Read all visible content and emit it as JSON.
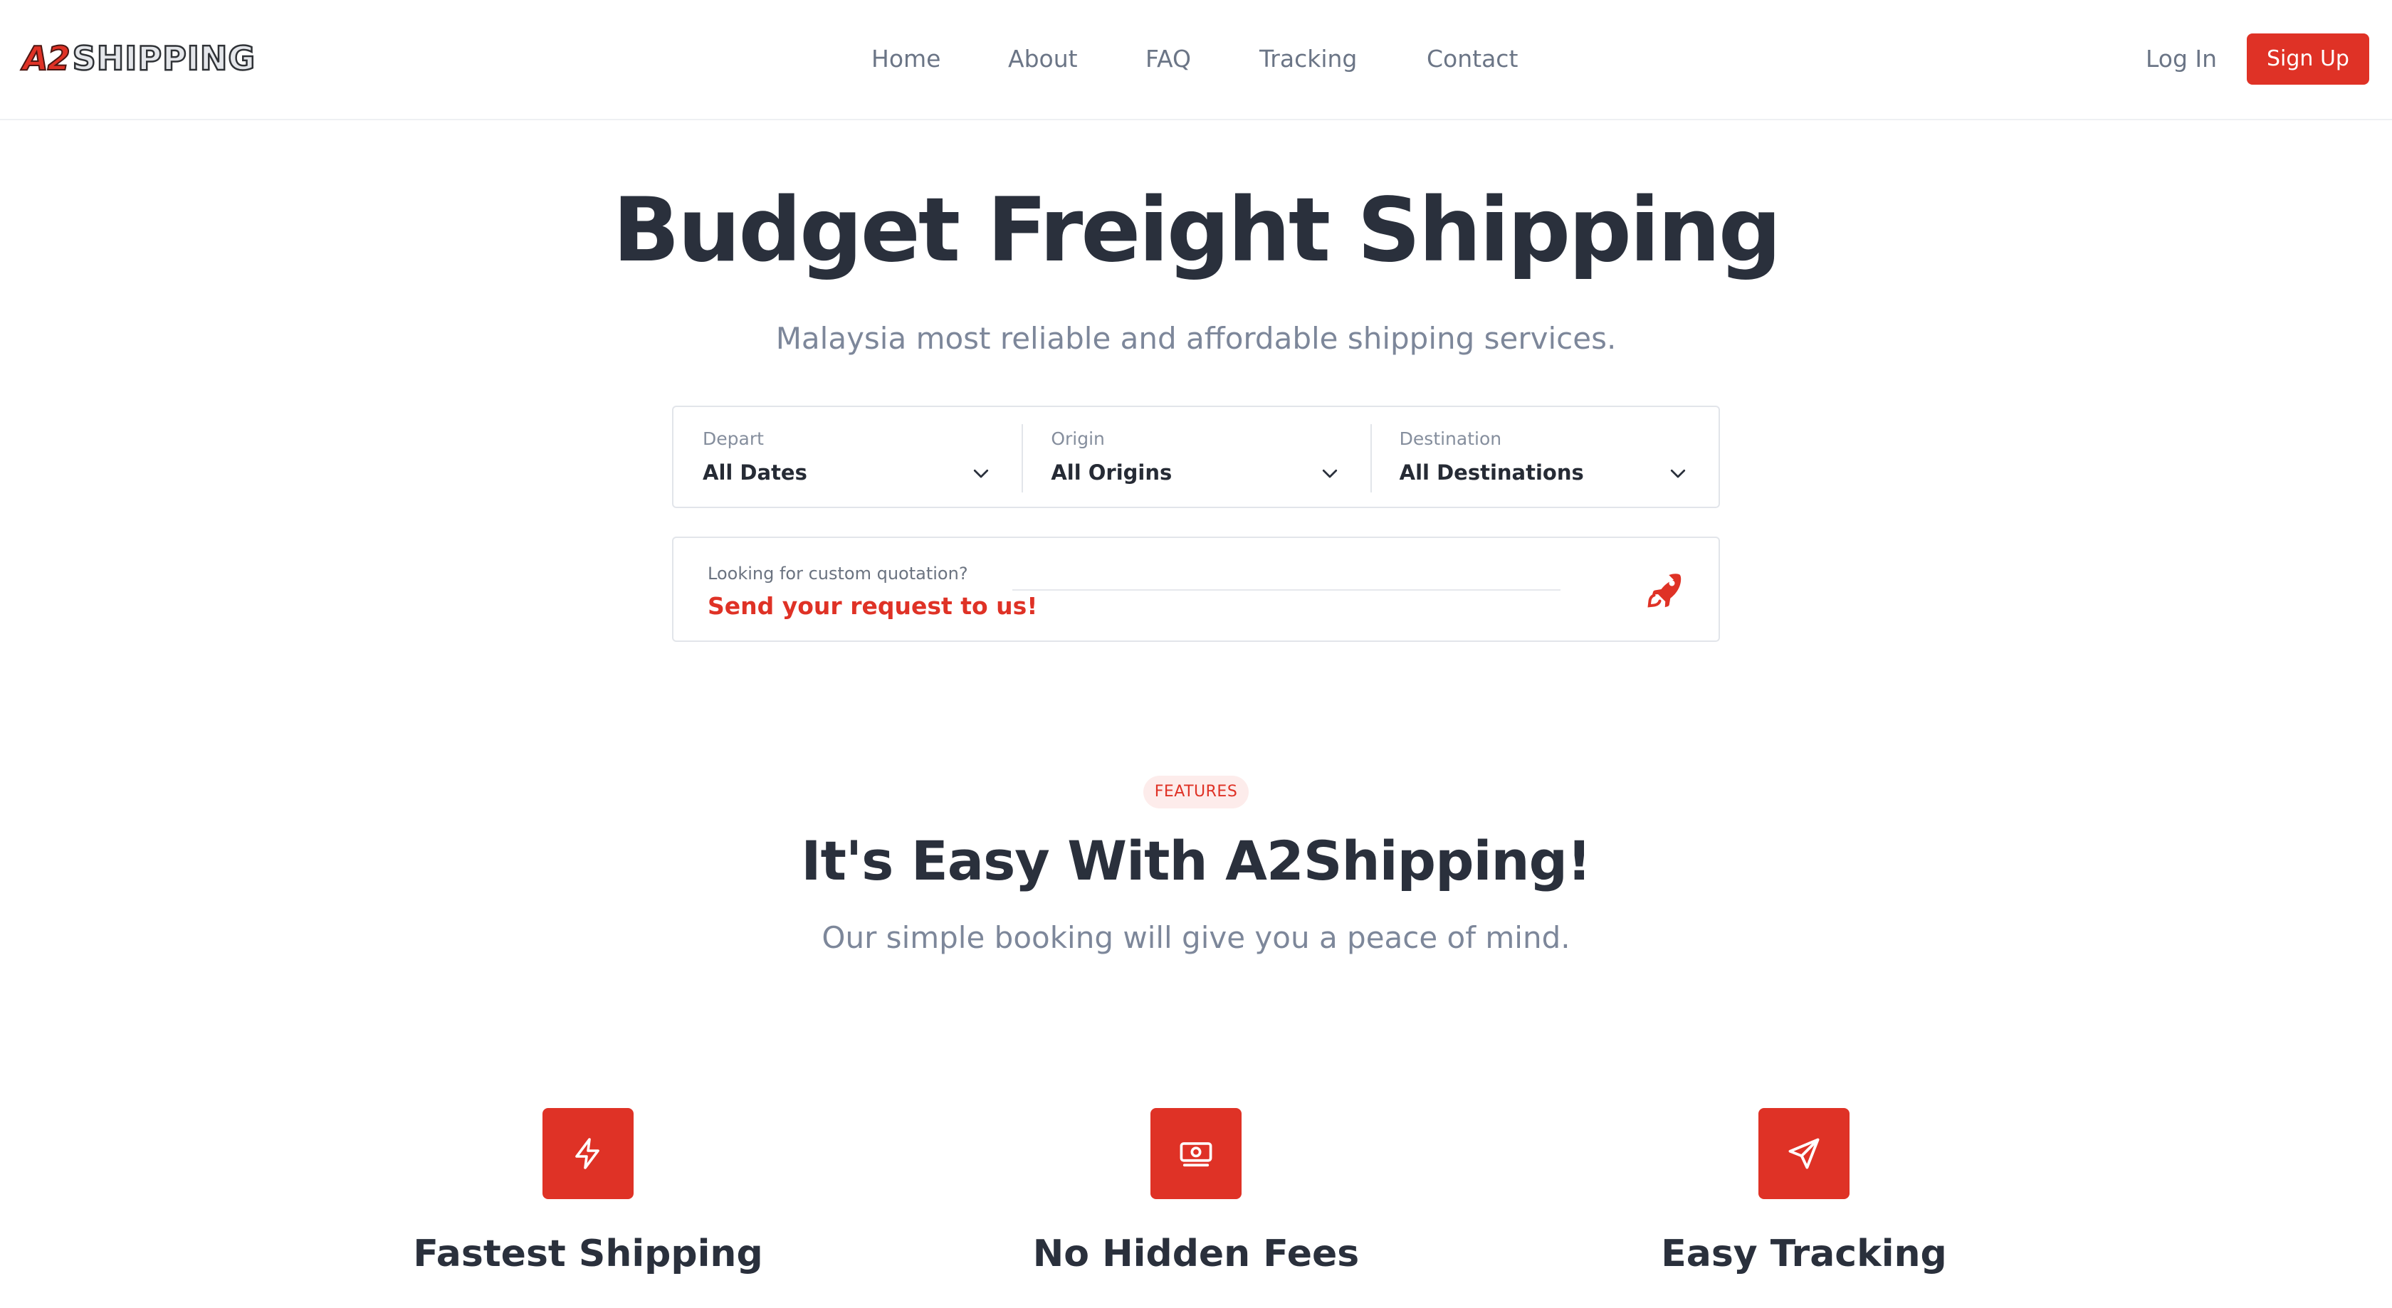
{
  "header": {
    "logo": {
      "part1": "A2",
      "part2": "SHIPPING"
    },
    "nav": [
      "Home",
      "About",
      "FAQ",
      "Tracking",
      "Contact"
    ],
    "login": "Log In",
    "signup": "Sign Up"
  },
  "hero": {
    "title": "Budget Freight Shipping",
    "subtitle": "Malaysia most reliable and affordable shipping services."
  },
  "filters": [
    {
      "label": "Depart",
      "value": "All Dates"
    },
    {
      "label": "Origin",
      "value": "All Origins"
    },
    {
      "label": "Destination",
      "value": "All Destinations"
    }
  ],
  "quote": {
    "label": "Looking for custom quotation?",
    "cta": "Send your request to us!",
    "icon": "rocket-icon"
  },
  "features": {
    "badge": "FEATURES",
    "title": "It's Easy With A2Shipping!",
    "subtitle": "Our simple booking will give you a peace of mind.",
    "items": [
      {
        "name": "Fastest Shipping",
        "icon": "lightning-icon"
      },
      {
        "name": "No Hidden Fees",
        "icon": "cash-icon"
      },
      {
        "name": "Easy Tracking",
        "icon": "paper-plane-icon"
      }
    ]
  },
  "colors": {
    "accent": "#df3226",
    "text": "#2a303c",
    "muted": "#7d879a"
  }
}
